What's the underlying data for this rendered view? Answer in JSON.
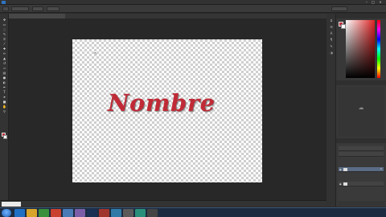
{
  "canvas": {
    "text": "Nombre",
    "text_color": "#c02a36"
  },
  "document_tab": {
    "title": ""
  },
  "status": {
    "zoom": ""
  },
  "colors": {
    "foreground": "#c0303a",
    "background": "#ffffff",
    "app_accent": "#2f74c0"
  },
  "icons": {
    "app_logo": "photoshop-logo",
    "move_tool": "move-icon",
    "brush_tool": "brush-icon",
    "text_tool": "text-tool-icon",
    "zoom_tool": "zoom-icon",
    "cc_libraries": "creative-cloud-icon",
    "start": "windows-start-icon",
    "layer_visibility": "eye-icon",
    "effects": "fx-icon"
  },
  "layers_panel": {
    "rows": [
      {
        "name": "",
        "fx": "fx"
      },
      {
        "name": "",
        "fx": ""
      }
    ],
    "effects": [
      "",
      ""
    ]
  },
  "taskbar": {
    "apps": [
      {
        "icon": "ie-icon",
        "color": "#1f6fc4"
      },
      {
        "icon": "explorer-icon",
        "color": "#d9a42b"
      },
      {
        "icon": "media-icon",
        "color": "#3a8f3a"
      },
      {
        "icon": "chrome-icon",
        "color": "#c9412f"
      },
      {
        "icon": "app-icon",
        "color": "#4a7bb7"
      },
      {
        "icon": "app-icon",
        "color": "#7b5ea7"
      },
      {
        "icon": "photoshop-icon",
        "color": "#1a2f54"
      },
      {
        "icon": "app-icon",
        "color": "#a0352e"
      },
      {
        "icon": "app-icon",
        "color": "#2f7aa7"
      },
      {
        "icon": "app-icon",
        "color": "#5a5a5a"
      },
      {
        "icon": "app-icon",
        "color": "#2a8f7b"
      },
      {
        "icon": "app-icon",
        "color": "#444"
      }
    ]
  }
}
